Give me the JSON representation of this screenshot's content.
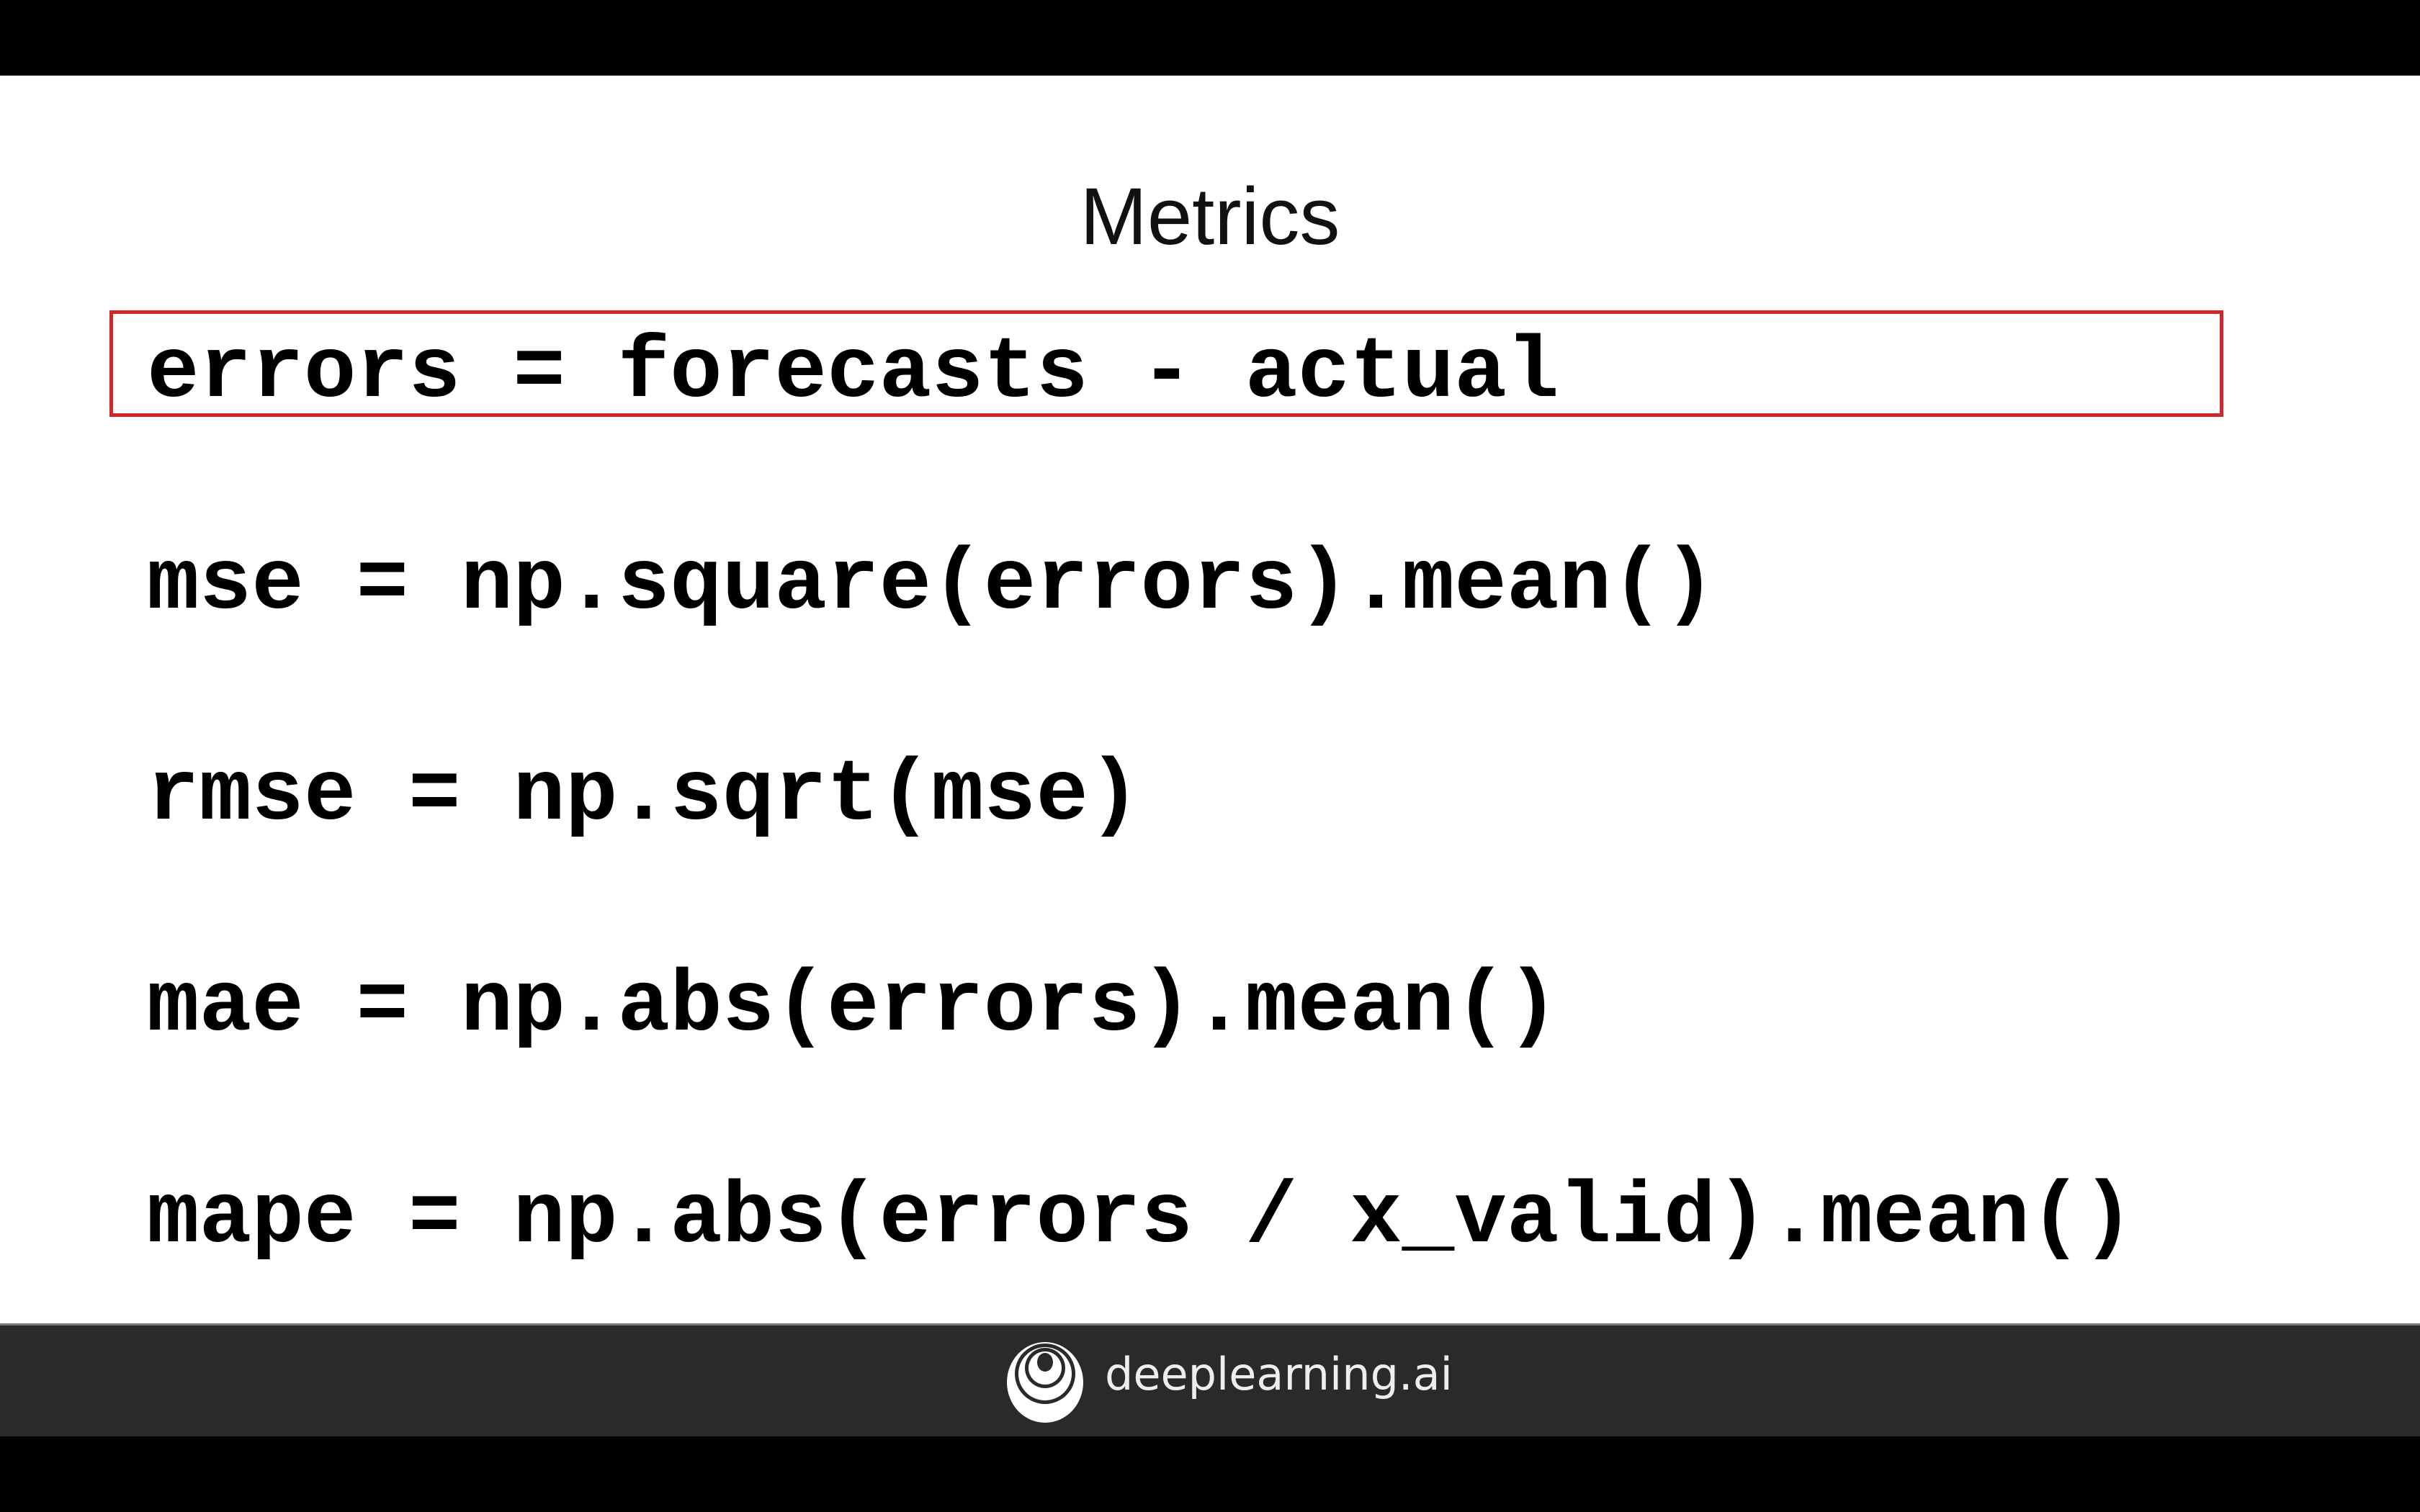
{
  "slide": {
    "title": "Metrics",
    "lines": [
      "errors = forecasts - actual",
      "mse = np.square(errors).mean()",
      "rmse = np.sqrt(mse)",
      "mae = np.abs(errors).mean()",
      "mape = np.abs(errors / x_valid).mean()"
    ],
    "highlight_color": "#d02828"
  },
  "footer": {
    "brand": "deeplearning.ai",
    "logo_icon": "deeplearning-logo-icon"
  }
}
